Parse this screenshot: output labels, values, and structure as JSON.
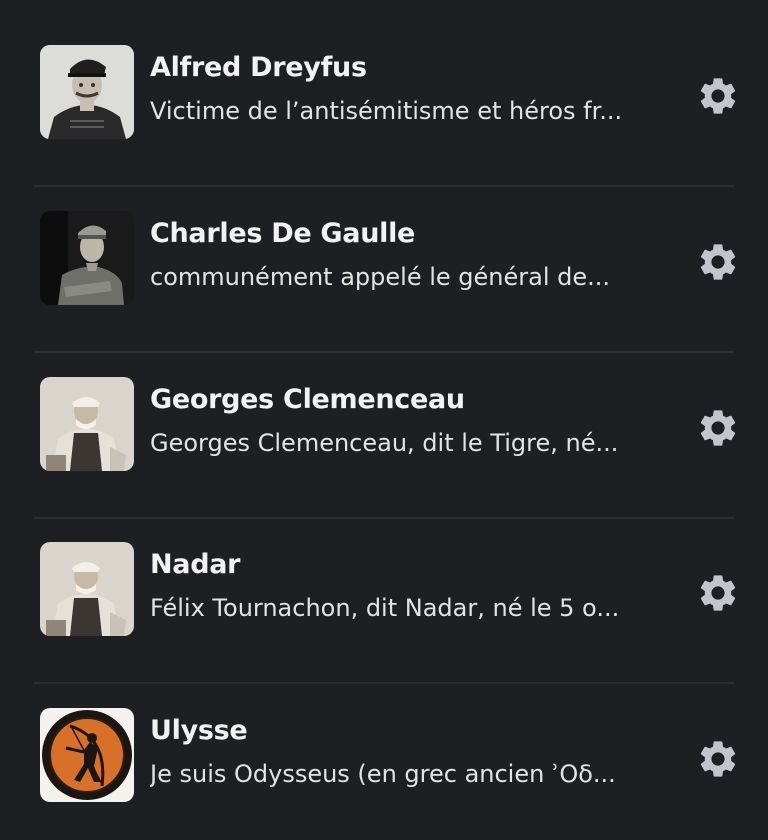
{
  "contacts": [
    {
      "name": "Alfred Dreyfus",
      "description": "Victime de l’antisémitisme et héros fr...",
      "avatar": "portrait-military-officer"
    },
    {
      "name": "Charles De Gaulle",
      "description": "communément appelé le général de...",
      "avatar": "portrait-general-uniform"
    },
    {
      "name": "Georges Clemenceau",
      "description": "Georges Clemenceau, dit le Tigre, né...",
      "avatar": "portrait-seated-man"
    },
    {
      "name": "Nadar",
      "description": "Félix Tournachon, dit Nadar, né le 5 o...",
      "avatar": "portrait-seated-man"
    },
    {
      "name": "Ulysse",
      "description": "Je suis  Odysseus (en grec ancien ʾΟδ...",
      "avatar": "greek-archer-plate"
    }
  ],
  "colors": {
    "background": "#1e1f22",
    "divider": "#2c2d31",
    "name": "#f2f2f2",
    "description": "#e3e3e3",
    "gear": "#c4c4cc"
  },
  "icons": {
    "settings": "gear-icon"
  }
}
